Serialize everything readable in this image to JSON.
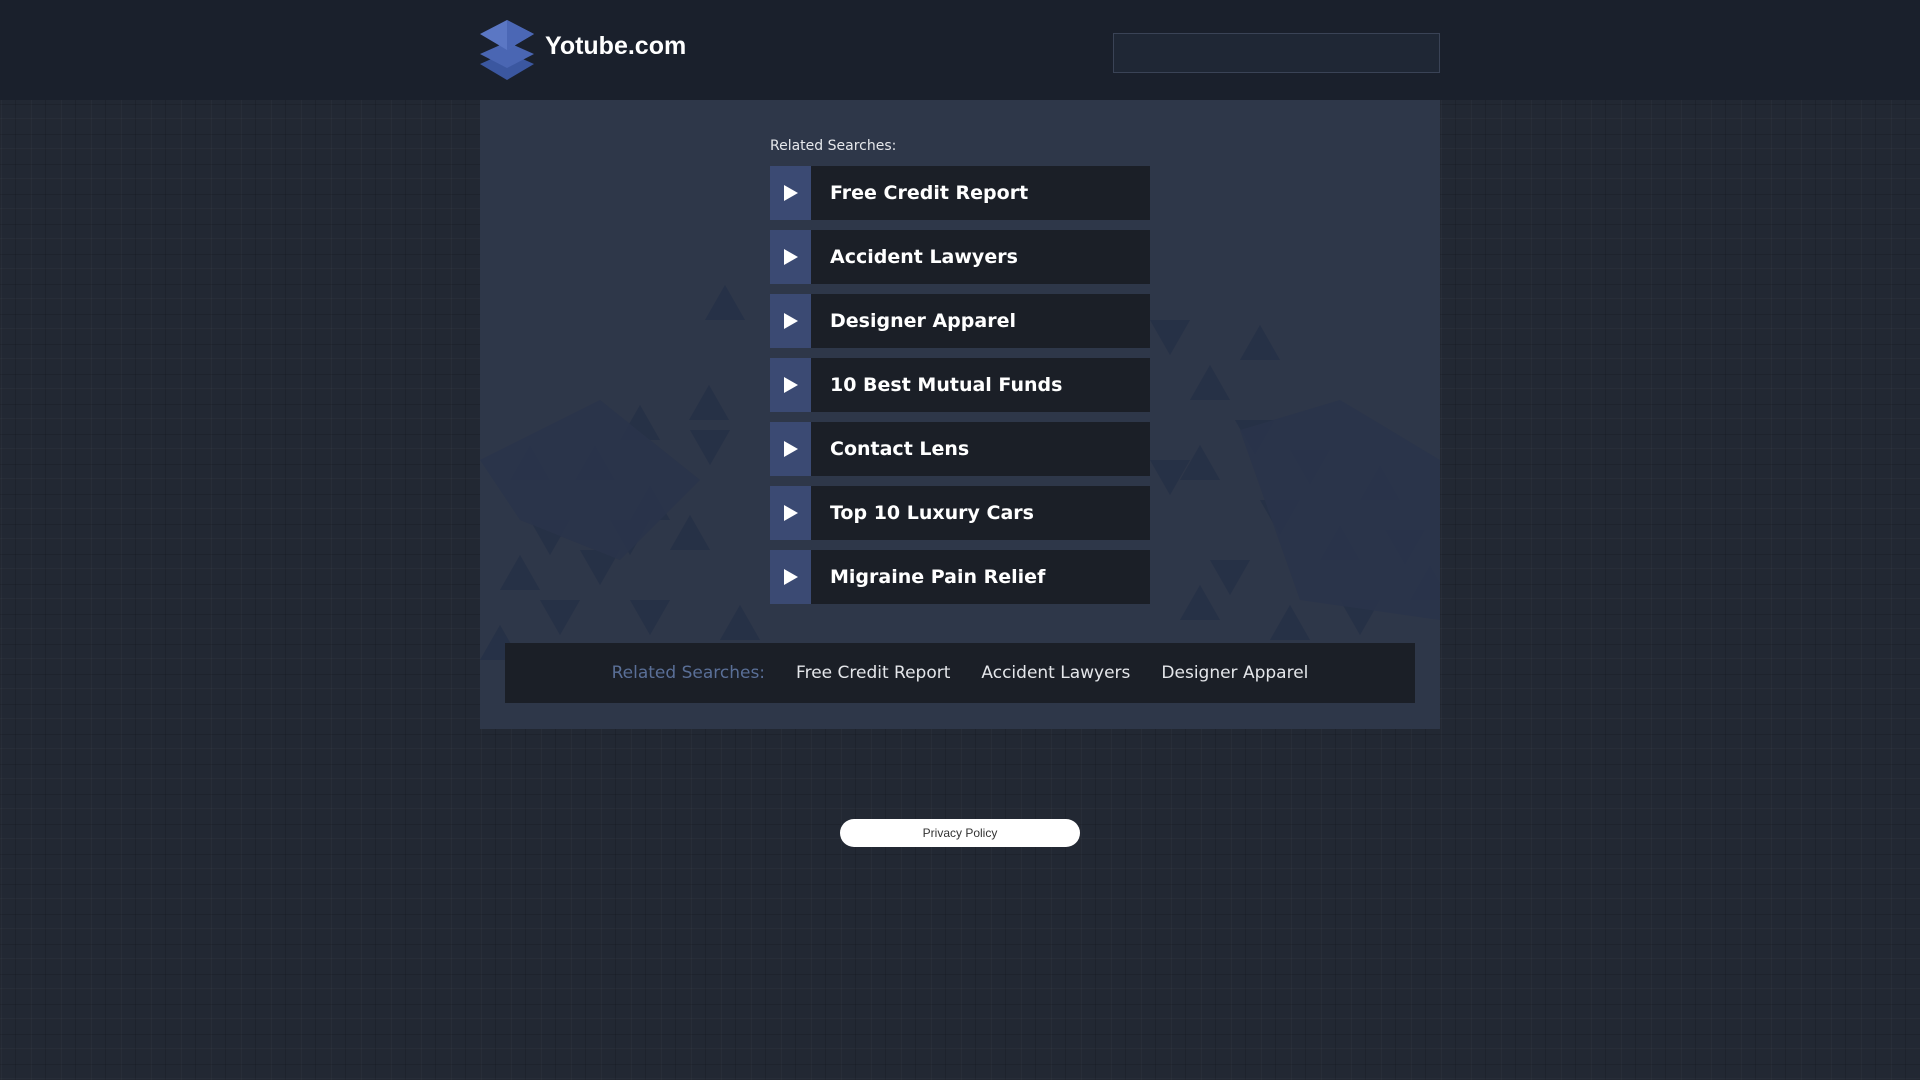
{
  "header": {
    "site_title": "Yotube.com",
    "logo_icon": "stacked-layers-logo",
    "search_placeholder": ""
  },
  "main": {
    "related_heading": "Related Searches:",
    "links": [
      {
        "label": "Free Credit Report",
        "icon": "play-arrow-icon"
      },
      {
        "label": "Accident Lawyers",
        "icon": "play-arrow-icon"
      },
      {
        "label": "Designer Apparel",
        "icon": "play-arrow-icon"
      },
      {
        "label": "10 Best Mutual Funds",
        "icon": "play-arrow-icon"
      },
      {
        "label": "Contact Lens",
        "icon": "play-arrow-icon"
      },
      {
        "label": "Top 10 Luxury Cars",
        "icon": "play-arrow-icon"
      },
      {
        "label": "Migraine Pain Relief",
        "icon": "play-arrow-icon"
      }
    ]
  },
  "bottom_bar": {
    "label": "Related Searches:",
    "links": [
      "Free Credit Report",
      "Accident Lawyers",
      "Designer Apparel"
    ]
  },
  "footer": {
    "privacy_label": "Privacy Policy"
  },
  "colors": {
    "background": "#222833",
    "header": "#1a202c",
    "panel": "#2e3749",
    "arrow_box": "#3b4a73",
    "link_box": "#1b1f27",
    "bottom_label": "#5a6f97"
  }
}
